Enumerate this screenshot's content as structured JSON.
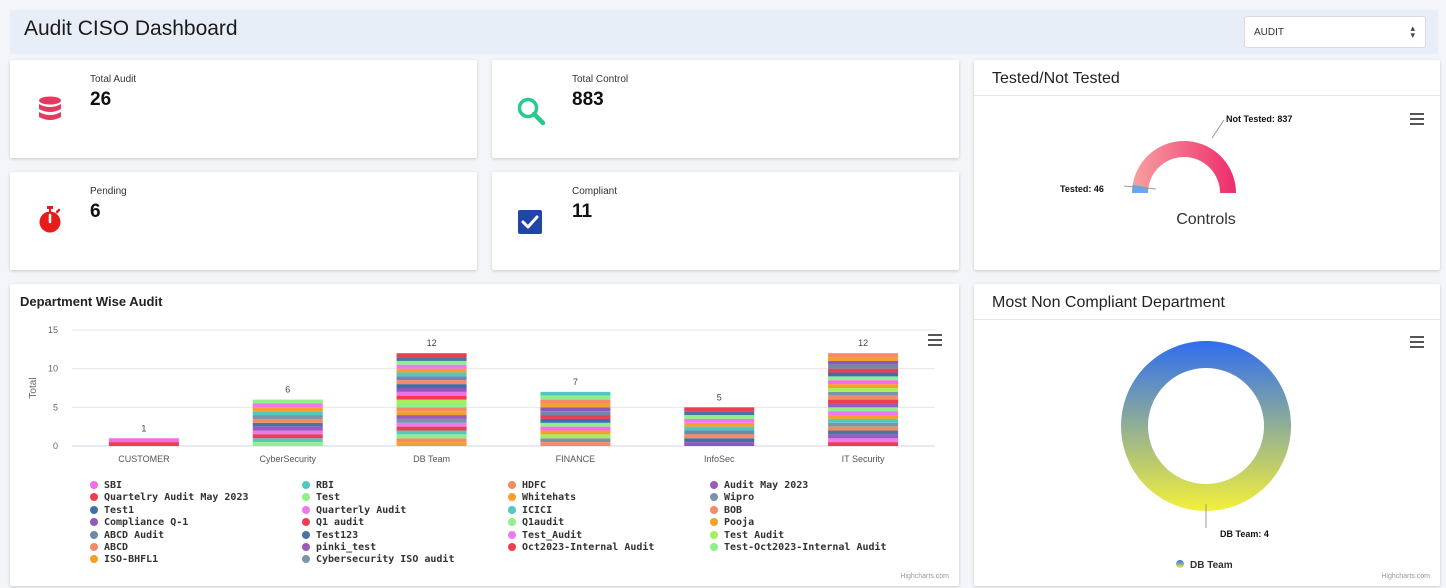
{
  "header": {
    "title": "Audit CISO Dashboard",
    "select_value": "AUDIT"
  },
  "stats": {
    "total_audit": {
      "label": "Total Audit",
      "value": "26"
    },
    "total_control": {
      "label": "Total Control",
      "value": "883"
    },
    "pending": {
      "label": "Pending",
      "value": "6"
    },
    "compliant": {
      "label": "Compliant",
      "value": "11"
    }
  },
  "icons": {
    "total_audit": "database-icon",
    "total_control": "search-icon",
    "pending": "stopwatch-icon",
    "compliant": "checkbox-icon",
    "menu": "hamburger-menu-icon"
  },
  "colors": {
    "database": "#e43a5f",
    "search": "#29c98b",
    "stopwatch": "#e81b1b",
    "checkbox": "#1f45a8",
    "gauge_start": "#f7a0a0",
    "gauge_end": "#ee2c6c"
  },
  "credit": "Highcharts.com",
  "chart_data": [
    {
      "type": "pie",
      "variant": "semi-donut",
      "title": "Tested/Not Tested",
      "center_label": "Controls",
      "slices": [
        {
          "name": "Tested",
          "value": 46,
          "label": "Tested: 46",
          "color": "#6aa7e8"
        },
        {
          "name": "Not Tested",
          "value": 837,
          "label": "Not Tested: 837",
          "color": "#f2577f"
        }
      ]
    },
    {
      "type": "bar",
      "stacked": true,
      "title": "Department Wise Audit",
      "ylabel": "Total",
      "ylim": [
        0,
        15
      ],
      "yticks": [
        "0",
        "5",
        "10",
        "15"
      ],
      "categories": [
        "CUSTOMER",
        "CyberSecurity",
        "DB Team",
        "FINANCE",
        "InfoSec",
        "IT Security"
      ],
      "totals": [
        1,
        6,
        12,
        7,
        5,
        12
      ],
      "legend": [
        {
          "name": "SBI",
          "color": "#f06ee6"
        },
        {
          "name": "Quartelry Audit May 2023",
          "color": "#ef3d4f"
        },
        {
          "name": "Test1",
          "color": "#3f6fa8"
        },
        {
          "name": "Compliance Q-1",
          "color": "#8e59b8"
        },
        {
          "name": "ABCD Audit",
          "color": "#6e8aa6"
        },
        {
          "name": "ABCD",
          "color": "#f58a63"
        },
        {
          "name": "ISO-BHFL1",
          "color": "#f5a028"
        },
        {
          "name": "RBI",
          "color": "#52c8c0"
        },
        {
          "name": "Test",
          "color": "#8ff08a"
        },
        {
          "name": "Quarterly Audit",
          "color": "#ef77f0"
        },
        {
          "name": "Q1 audit",
          "color": "#ef3d4f"
        },
        {
          "name": "Test123",
          "color": "#4b73a3"
        },
        {
          "name": "pinki_test",
          "color": "#9a5bbd"
        },
        {
          "name": "Cybersecurity ISO audit",
          "color": "#7c93ab"
        },
        {
          "name": "HDFC",
          "color": "#f58a63"
        },
        {
          "name": "Whitehats",
          "color": "#f5a028"
        },
        {
          "name": "ICICI",
          "color": "#52c8c0"
        },
        {
          "name": "Q1audit",
          "color": "#8ff08a"
        },
        {
          "name": "Test_Audit",
          "color": "#ef77f0"
        },
        {
          "name": "Oct2023-Internal Audit",
          "color": "#ef3d4f"
        },
        {
          "name": "Audit May 2023",
          "color": "#9a5bbd"
        },
        {
          "name": "Wipro",
          "color": "#7c93ab"
        },
        {
          "name": "BOB",
          "color": "#f58a63"
        },
        {
          "name": "Pooja",
          "color": "#f5a028"
        },
        {
          "name": "Test Audit",
          "color": "#a3f05c"
        },
        {
          "name": "Test-Oct2023-Internal Audit",
          "color": "#8ff08a"
        }
      ]
    },
    {
      "type": "pie",
      "variant": "donut",
      "title": "Most Non Compliant Department",
      "slices": [
        {
          "name": "DB Team",
          "value": 4,
          "label": "DB Team: 4"
        }
      ],
      "gradient": [
        "#2f6df0",
        "#f3f03a"
      ],
      "legend": [
        "DB Team"
      ]
    }
  ]
}
